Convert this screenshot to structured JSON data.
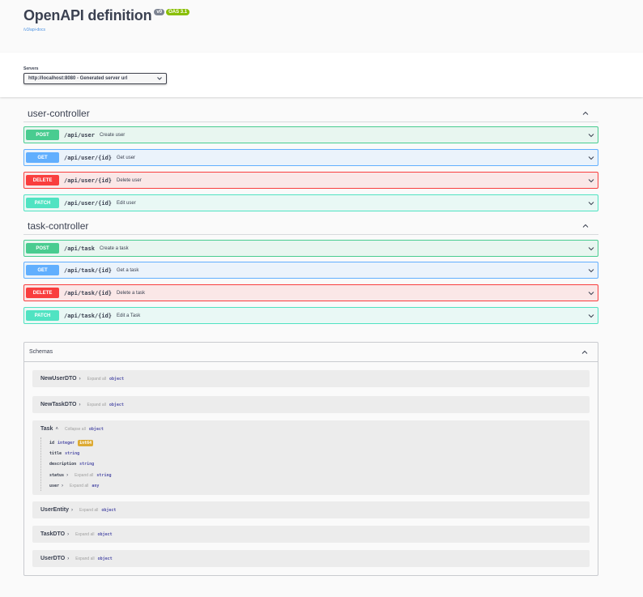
{
  "info": {
    "title": "OpenAPI definition",
    "version_badge": "v0",
    "oas_badge": "OAS 3.1",
    "docs_link": "/v3/api-docs"
  },
  "servers": {
    "label": "Servers",
    "selected": "http://localhost:8080 - Generated server url"
  },
  "tags": [
    {
      "name": "user-controller",
      "operations": [
        {
          "method": "POST",
          "path": "/api/user",
          "summary": "Create user"
        },
        {
          "method": "GET",
          "path": "/api/user/{id}",
          "summary": "Get user"
        },
        {
          "method": "DELETE",
          "path": "/api/user/{id}",
          "summary": "Delete user"
        },
        {
          "method": "PATCH",
          "path": "/api/user/{id}",
          "summary": "Edit user"
        }
      ]
    },
    {
      "name": "task-controller",
      "operations": [
        {
          "method": "POST",
          "path": "/api/task",
          "summary": "Create a task"
        },
        {
          "method": "GET",
          "path": "/api/task/{id}",
          "summary": "Get a task"
        },
        {
          "method": "DELETE",
          "path": "/api/task/{id}",
          "summary": "Delete a task"
        },
        {
          "method": "PATCH",
          "path": "/api/task/{id}",
          "summary": "Edit a Task"
        }
      ]
    }
  ],
  "schemas": {
    "title": "Schemas",
    "models": [
      {
        "name": "NewUserDTO",
        "expand": "Expand all",
        "type": "object"
      },
      {
        "name": "NewTaskDTO",
        "expand": "Expand all",
        "type": "object"
      },
      {
        "name": "Task",
        "expand": "Collapse all",
        "type": "object",
        "properties": [
          {
            "name": "id",
            "type": "integer",
            "format": "int64"
          },
          {
            "name": "title",
            "type": "string"
          },
          {
            "name": "description",
            "type": "string"
          },
          {
            "name": "status",
            "expand": "Expand all",
            "type": "string"
          },
          {
            "name": "user",
            "expand": "Expand all",
            "type": "any"
          }
        ]
      },
      {
        "name": "UserEntity",
        "expand": "Expand all",
        "type": "object"
      },
      {
        "name": "TaskDTO",
        "expand": "Expand all",
        "type": "object"
      },
      {
        "name": "UserDTO",
        "expand": "Expand all",
        "type": "object"
      }
    ]
  },
  "colors": {
    "post": "#49cc90",
    "get": "#61affe",
    "delete": "#f93e3e",
    "patch": "#50e3c2",
    "format_badge": "#ddaa33"
  }
}
